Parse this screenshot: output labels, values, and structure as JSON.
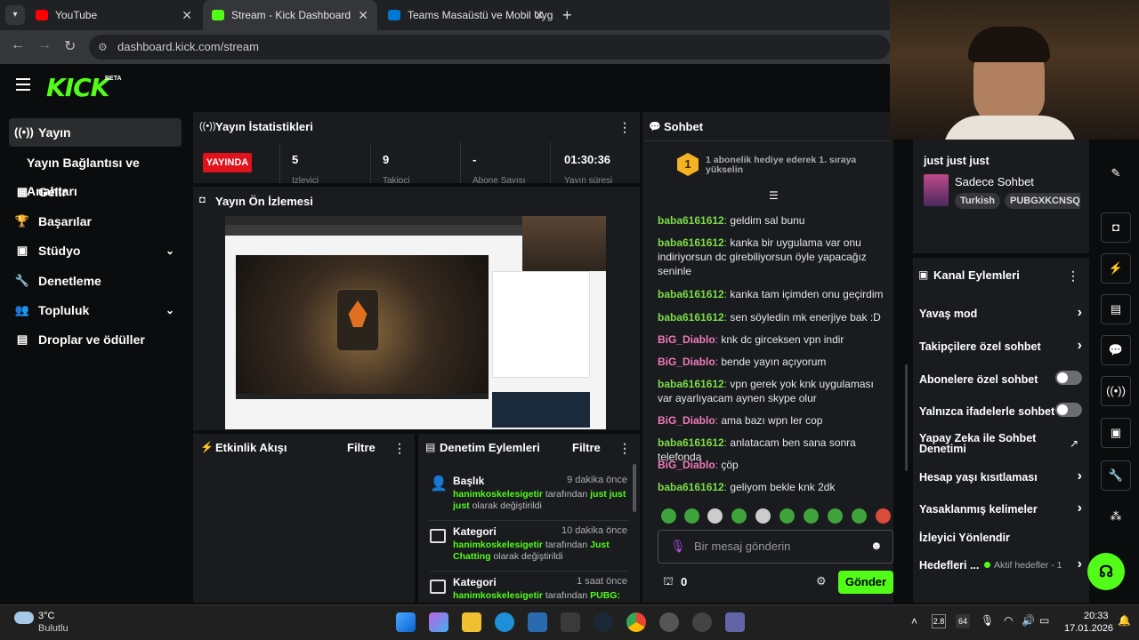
{
  "browser": {
    "tabs": [
      {
        "title": "YouTube",
        "color": "#ff0000"
      },
      {
        "title": "Stream - Kick Dashboard",
        "color": "#53fc18"
      },
      {
        "title": "Teams Masaüstü ve Mobil Uygu",
        "color": "#0078d4"
      }
    ],
    "url": "dashboard.kick.com/stream"
  },
  "brand": {
    "logo": "KICK",
    "badge": "BETA",
    "accent": "#53fc18"
  },
  "sidebar": {
    "items": [
      {
        "label": "Yayın",
        "icon": "broadcast-icon"
      },
      {
        "label": "Yayın Bağlantısı ve Anahtarı",
        "icon": ""
      },
      {
        "label": "Gelir",
        "icon": "revenue-icon"
      },
      {
        "label": "Başarılar",
        "icon": "trophy-icon"
      },
      {
        "label": "Stüdyo",
        "icon": "studio-icon"
      },
      {
        "label": "Denetleme",
        "icon": "wrench-icon"
      },
      {
        "label": "Topluluk",
        "icon": "people-icon"
      },
      {
        "label": "Droplar ve ödüller",
        "icon": "gift-icon"
      }
    ]
  },
  "stats": {
    "title": "Yayın İstatistikleri",
    "live": "YAYINDA",
    "items": [
      {
        "value": "5",
        "label": "İzleyici"
      },
      {
        "value": "9",
        "label": "Takipçi"
      },
      {
        "value": "-",
        "label": "Abone Sayısı"
      },
      {
        "value": "01:30:36",
        "label": "Yayın süresi"
      }
    ]
  },
  "preview": {
    "title": "Yayın Ön İzlemesi"
  },
  "flow": {
    "title": "Etkinlik Akışı",
    "filter": "Filtre"
  },
  "mod": {
    "title": "Denetim Eylemleri",
    "filter": "Filtre",
    "items": [
      {
        "type": "Başlık",
        "time": "9 dakika önce",
        "user": "hanimkoskelesigetir",
        "by": "tarafından",
        "value": "just just just",
        "rest": "olarak değiştirildi"
      },
      {
        "type": "Kategori",
        "time": "10 dakika önce",
        "user": "hanimkoskelesigetir",
        "by": "tarafından",
        "value": "Just Chatting",
        "rest": "olarak değiştirildi"
      },
      {
        "type": "Kategori",
        "time": "1 saat önce",
        "user": "hanimkoskelesigetir",
        "by": "tarafından",
        "value": "PUBG:",
        "rest": ""
      }
    ]
  },
  "chat": {
    "title": "Sohbet",
    "pinned": "1 abonelik hediye ederek 1. sıraya yükselin",
    "gift_rank": "1",
    "messages": [
      {
        "user": "baba6161612",
        "text": "geldim sal bunu",
        "c": "g"
      },
      {
        "user": "baba6161612",
        "text": "kanka bir uygulama var onu indiriyorsun dc girebiliyorsun öyle yapacağız seninle",
        "c": "g"
      },
      {
        "user": "baba6161612",
        "text": "kanka tam içimden onu geçirdim",
        "c": "g"
      },
      {
        "user": "baba6161612",
        "text": "sen söyledin mk enerjiye bak :D",
        "c": "g"
      },
      {
        "user": "BiG_Diablo",
        "text": "knk dc girceksen vpn indir",
        "c": "p"
      },
      {
        "user": "BiG_Diablo",
        "text": "bende yayın açıyorum",
        "c": "p"
      },
      {
        "user": "baba6161612",
        "text": "vpn gerek yok knk uygulaması var ayarlıyacam aynen skype olur",
        "c": "g"
      },
      {
        "user": "BiG_Diablo",
        "text": "ama bazı wpn ler cop",
        "c": "p"
      },
      {
        "user": "baba6161612",
        "text": "anlatacam ben sana sonra telefonda",
        "c": "g"
      },
      {
        "user": "BiG_Diablo",
        "text": "çöp",
        "c": "p"
      },
      {
        "user": "baba6161612",
        "text": "geliyom bekle knk 2dk",
        "c": "g"
      }
    ],
    "placeholder": "Bir mesaj gönderin",
    "points": "0",
    "send": "Gönder"
  },
  "streaminfo": {
    "title": "just just just",
    "category": "Sadece Sohbet",
    "tags": [
      "Turkish",
      "PUBGXKCNSQU"
    ]
  },
  "channel": {
    "title": "Kanal Eylemleri",
    "items": [
      {
        "label": "Yavaş mod",
        "ctrl": "arrow"
      },
      {
        "label": "Takipçilere özel sohbet",
        "ctrl": "arrow"
      },
      {
        "label": "Abonelere özel sohbet",
        "ctrl": "toggle"
      },
      {
        "label": "Yalnızca ifadelerle sohbet",
        "ctrl": "toggle"
      },
      {
        "label": "Yapay Zeka ile Sohbet Denetimi",
        "ctrl": "external"
      },
      {
        "label": "Hesap yaşı kısıtlaması",
        "ctrl": "arrow"
      },
      {
        "label": "Yasaklanmış kelimeler",
        "ctrl": "arrow"
      },
      {
        "label": "İzleyici Yönlendir",
        "ctrl": ""
      },
      {
        "label": "Hedefleri ...",
        "ctrl": "arrow",
        "status": "Aktif hedefler - 1"
      }
    ]
  },
  "taskbar": {
    "weather_temp": "3°C",
    "weather_text": "Bulutlu",
    "time": "20:33",
    "date": "17.01.2026",
    "tray": [
      "2.8",
      "64"
    ]
  }
}
